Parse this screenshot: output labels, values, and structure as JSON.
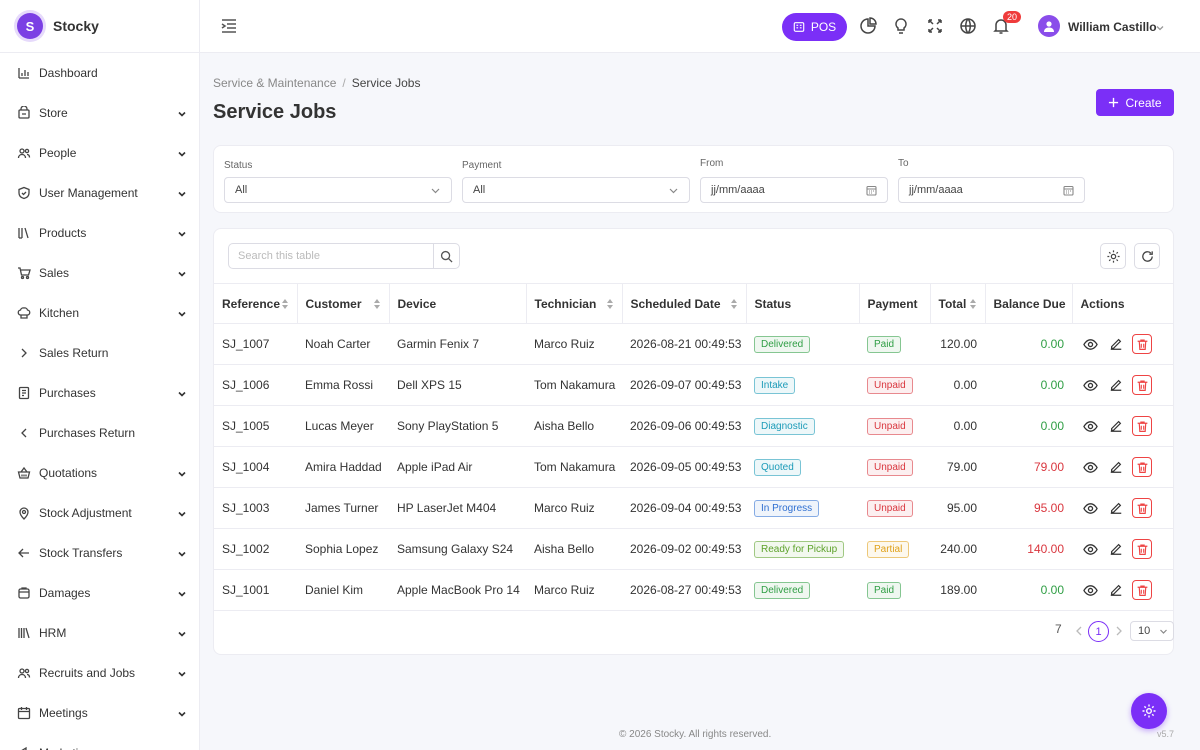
{
  "brand": {
    "logo_letter": "S",
    "name": "Stocky"
  },
  "sidebar": {
    "items": [
      {
        "label": "Dashboard",
        "icon": "chart-bar-icon",
        "expandable": false
      },
      {
        "label": "Store",
        "icon": "store-icon",
        "expandable": true
      },
      {
        "label": "People",
        "icon": "users-icon",
        "expandable": true
      },
      {
        "label": "User Management",
        "icon": "shield-icon",
        "expandable": true
      },
      {
        "label": "Products",
        "icon": "books-icon",
        "expandable": true
      },
      {
        "label": "Sales",
        "icon": "cart-icon",
        "expandable": true
      },
      {
        "label": "Kitchen",
        "icon": "chef-hat-icon",
        "expandable": true
      },
      {
        "label": "Sales Return",
        "icon": "chevron-right-icon",
        "expandable": false
      },
      {
        "label": "Purchases",
        "icon": "receipt-icon",
        "expandable": true
      },
      {
        "label": "Purchases Return",
        "icon": "chevron-left-icon",
        "expandable": false
      },
      {
        "label": "Quotations",
        "icon": "basket-icon",
        "expandable": true
      },
      {
        "label": "Stock Adjustment",
        "icon": "map-pin-icon",
        "expandable": true
      },
      {
        "label": "Stock Transfers",
        "icon": "arrow-left-icon",
        "expandable": true
      },
      {
        "label": "Damages",
        "icon": "box-icon",
        "expandable": true
      },
      {
        "label": "HRM",
        "icon": "library-icon",
        "expandable": true
      },
      {
        "label": "Recruits and Jobs",
        "icon": "users-icon",
        "expandable": true
      },
      {
        "label": "Meetings",
        "icon": "calendar-icon",
        "expandable": true
      },
      {
        "label": "Marketing",
        "icon": "megaphone-icon",
        "expandable": true
      }
    ]
  },
  "header": {
    "pos_label": "POS",
    "notification_count": "20",
    "user_name": "William Castillo"
  },
  "breadcrumb": {
    "parent": "Service & Maintenance",
    "separator": "/",
    "current": "Service Jobs"
  },
  "page": {
    "title": "Service Jobs",
    "create_label": "Create"
  },
  "filters": {
    "status": {
      "label": "Status",
      "value": "All"
    },
    "payment": {
      "label": "Payment",
      "value": "All"
    },
    "from": {
      "label": "From",
      "value": "jj/mm/aaaa"
    },
    "to": {
      "label": "To",
      "value": "jj/mm/aaaa"
    }
  },
  "table": {
    "search_placeholder": "Search this table",
    "columns": [
      "Reference",
      "Customer",
      "Device",
      "Technician",
      "Scheduled Date",
      "Status",
      "Payment",
      "Total",
      "Balance Due",
      "Actions"
    ],
    "rows": [
      {
        "ref": "SJ_1007",
        "customer": "Noah Carter",
        "device": "Garmin Fenix 7",
        "tech": "Marco Ruiz",
        "date": "2026-08-21 00:49:53",
        "status": "Delivered",
        "status_color": "#2f9e44",
        "payment": "Paid",
        "payment_color": "#2f9e44",
        "total": "120.00",
        "balance": "0.00",
        "due": false
      },
      {
        "ref": "SJ_1006",
        "customer": "Emma Rossi",
        "device": "Dell XPS 15",
        "tech": "Tom Nakamura",
        "date": "2026-09-07 00:49:53",
        "status": "Intake",
        "status_color": "#1c9bb8",
        "payment": "Unpaid",
        "payment_color": "#d9363e",
        "total": "0.00",
        "balance": "0.00",
        "due": false
      },
      {
        "ref": "SJ_1005",
        "customer": "Lucas Meyer",
        "device": "Sony PlayStation 5",
        "tech": "Aisha Bello",
        "date": "2026-09-06 00:49:53",
        "status": "Diagnostic",
        "status_color": "#1c9bb8",
        "payment": "Unpaid",
        "payment_color": "#d9363e",
        "total": "0.00",
        "balance": "0.00",
        "due": false
      },
      {
        "ref": "SJ_1004",
        "customer": "Amira Haddad",
        "device": "Apple iPad Air",
        "tech": "Tom Nakamura",
        "date": "2026-09-05 00:49:53",
        "status": "Quoted",
        "status_color": "#1c9bb8",
        "payment": "Unpaid",
        "payment_color": "#d9363e",
        "total": "79.00",
        "balance": "79.00",
        "due": true
      },
      {
        "ref": "SJ_1003",
        "customer": "James Turner",
        "device": "HP LaserJet M404",
        "tech": "Marco Ruiz",
        "date": "2026-09-04 00:49:53",
        "status": "In Progress",
        "status_color": "#2f6fd1",
        "payment": "Unpaid",
        "payment_color": "#d9363e",
        "total": "95.00",
        "balance": "95.00",
        "due": true
      },
      {
        "ref": "SJ_1002",
        "customer": "Sophia Lopez",
        "device": "Samsung Galaxy S24",
        "tech": "Aisha Bello",
        "date": "2026-09-02 00:49:53",
        "status": "Ready for Pickup",
        "status_color": "#5da22b",
        "payment": "Partial",
        "payment_color": "#e0a21b",
        "total": "240.00",
        "balance": "140.00",
        "due": true
      },
      {
        "ref": "SJ_1001",
        "customer": "Daniel Kim",
        "device": "Apple MacBook Pro 14",
        "tech": "Marco Ruiz",
        "date": "2026-08-27 00:49:53",
        "status": "Delivered",
        "status_color": "#2f9e44",
        "payment": "Paid",
        "payment_color": "#2f9e44",
        "total": "189.00",
        "balance": "0.00",
        "due": false
      }
    ]
  },
  "pagination": {
    "total": "7",
    "current_page": "1",
    "page_size": "10"
  },
  "footer": {
    "copyright": "© 2026 Stocky. All rights reserved.",
    "version": "v5.7"
  },
  "colors": {
    "accent": "#7b2ff7",
    "danger": "#d9363e",
    "success": "#2f9e44"
  }
}
